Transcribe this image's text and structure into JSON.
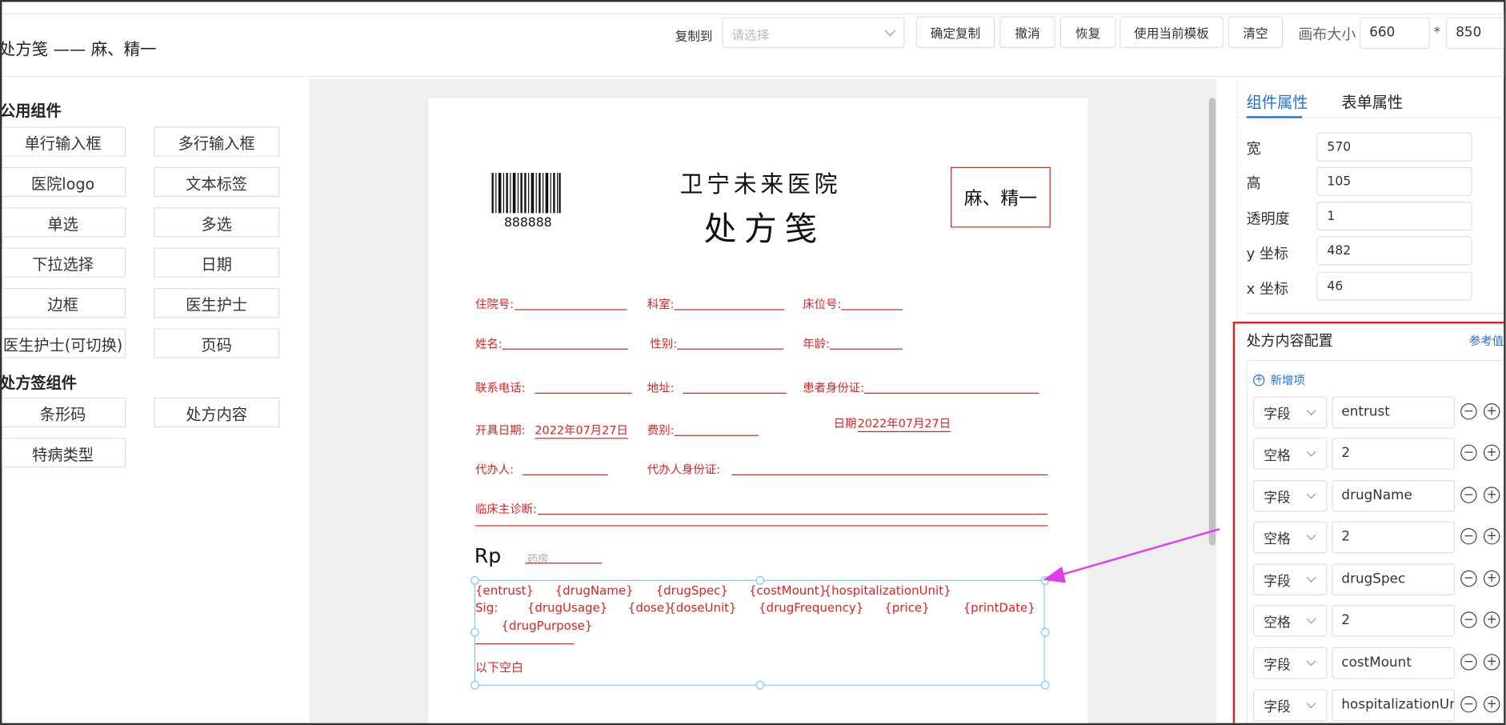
{
  "header": {
    "title": "处方笺 —— 麻、精一",
    "copy_to_label": "复制到",
    "copy_to_placeholder": "请选择",
    "buttons": [
      "确定复制",
      "撤消",
      "恢复",
      "使用当前模板",
      "清空"
    ],
    "canvas_size_label": "画布大小",
    "canvas_width": "660",
    "canvas_height": "850",
    "times": "*"
  },
  "palette": {
    "common_title": "公用组件",
    "common_items": [
      "单行输入框",
      "多行输入框",
      "医院logo",
      "文本标签",
      "单选",
      "多选",
      "下拉选择",
      "日期",
      "边框",
      "医生护士",
      "医生护士(可切换)",
      "页码"
    ],
    "rx_title": "处方签组件",
    "rx_items": [
      "条形码",
      "处方内容",
      "特病类型"
    ]
  },
  "paper": {
    "barcode_number": "888888",
    "hospital": "卫宁未来医院",
    "rx_title": "处方笺",
    "badge": "麻、精一",
    "fields": {
      "inpatient_no": "住院号:",
      "dept": "科室:",
      "bed_no": "床位号:",
      "name": "姓名:",
      "gender": "性别:",
      "age": "年龄:",
      "phone": "联系电话:",
      "address": "地址:",
      "patient_id": "患者身份证:",
      "open_date": "开具日期:",
      "open_date_value": "2022年07月27日",
      "fee": "费别:",
      "date": "日期",
      "date_value": "2022年07月27日",
      "agent": "代办人:",
      "agent_id": "代办人身份证:",
      "diagnosis": "临床主诊断:"
    },
    "rp": "Rp",
    "pharmacy": "药房",
    "content": {
      "line1": [
        "{entrust}",
        "{drugName}",
        "{drugSpec}",
        "{costMount}",
        "{hospitalizationUnit}"
      ],
      "line2": [
        "Sig:",
        "{drugUsage}",
        "{dose}",
        "{doseUnit}",
        "{drugFrequency}",
        "{price}",
        "{printDate}"
      ],
      "line3": "{drugPurpose}",
      "blank_below": "以下空白"
    }
  },
  "props": {
    "tabs": [
      "组件属性",
      "表单属性"
    ],
    "fields": [
      {
        "label": "宽",
        "value": "570"
      },
      {
        "label": "高",
        "value": "105"
      },
      {
        "label": "透明度",
        "value": "1"
      },
      {
        "label": "y 坐标",
        "value": "482"
      },
      {
        "label": "x 坐标",
        "value": "46"
      }
    ],
    "config_title": "处方内容配置",
    "reference_link": "参考值",
    "add_item": "新增项",
    "rows": [
      {
        "type": "字段",
        "value": "entrust"
      },
      {
        "type": "空格",
        "value": "2"
      },
      {
        "type": "字段",
        "value": "drugName"
      },
      {
        "type": "空格",
        "value": "2"
      },
      {
        "type": "字段",
        "value": "drugSpec"
      },
      {
        "type": "空格",
        "value": "2"
      },
      {
        "type": "字段",
        "value": "costMount"
      },
      {
        "type": "字段",
        "value": "hospitalizationUnit"
      }
    ]
  },
  "colors": {
    "accent": "#1f6fd8",
    "form_red": "#e02020",
    "selection": "#7ec8ff",
    "arrow": "#e23be8"
  },
  "icons": [
    "chevron-down-icon",
    "minus-circle-icon",
    "plus-circle-icon",
    "add-circle-icon",
    "barcode-icon",
    "arrow-annotation"
  ]
}
